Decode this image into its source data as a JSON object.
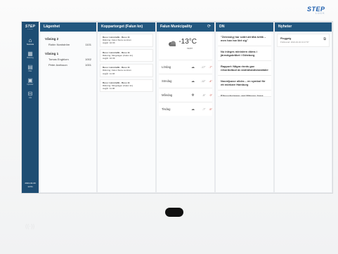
{
  "device": {
    "brand": "STEP",
    "brand_sub": "LOCK",
    "emboss": "((·))"
  },
  "sidebar": {
    "logo": "STEP",
    "logo_sub": "LOCK",
    "items": [
      {
        "label": "Startsida",
        "icon": "home-icon",
        "glyph": "⌂"
      },
      {
        "label": "Bokning",
        "icon": "calendar-icon",
        "glyph": "▦"
      },
      {
        "label": "Filer",
        "icon": "file-icon",
        "glyph": "▤"
      },
      {
        "label": "Nyheter",
        "icon": "newspaper-icon",
        "glyph": "▣"
      },
      {
        "label": "Lås",
        "icon": "lock-icon",
        "glyph": "⊟"
      }
    ],
    "date": "2024-02-09",
    "time": "14:51"
  },
  "lagenhet": {
    "title": "Lägenhet",
    "floors": [
      {
        "name": "Våning 2",
        "residents": [
          {
            "name": "Robin Nordström",
            "apt": "1101"
          }
        ]
      },
      {
        "name": "Våning 1",
        "residents": [
          {
            "name": "Tomas Engblom",
            "apt": "1002"
          },
          {
            "name": "Peter Axelsson",
            "apt": "1001"
          }
        ]
      }
    ]
  },
  "koppartorget": {
    "title": "Koppartorget (Falun kn)",
    "departures": [
      {
        "line": "Buss: Länstrafik - Buss 11",
        "dir": "Riktning: Falun Stora centrum",
        "arr": "Avgår: 10:33"
      },
      {
        "line": "Buss: Länstrafik - Buss 11",
        "dir": "Riktning: Slingvägen (Falun kn)",
        "arr": "Avgår: 10:36"
      },
      {
        "line": "Buss: Länstrafik - Buss 11",
        "dir": "Riktning: Falun Stora centrum",
        "arr": "Avgår: 11:03"
      },
      {
        "line": "Buss: Länstrafik - Buss 11",
        "dir": "Riktning: Slingvägen (Falun kn)",
        "arr": "Avgår: 11:06"
      }
    ]
  },
  "weather": {
    "title": "Falun Municipality",
    "now_temp": "-13°C",
    "now_cond": "mulet",
    "now_icon": "cloud-icon",
    "forecast": [
      {
        "day": "Lördag",
        "icon": "cloud-icon",
        "glyph": "☁",
        "lo": "-17°",
        "hi": "-7°"
      },
      {
        "day": "Söndag",
        "icon": "cloud-icon",
        "glyph": "☁",
        "lo": "-12°",
        "hi": "-4°"
      },
      {
        "day": "Måndag",
        "icon": "snow-icon",
        "glyph": "✻",
        "lo": "-5°",
        "hi": "0°"
      },
      {
        "day": "Tisdag",
        "icon": "cloud-icon",
        "glyph": "☁",
        "lo": "-7°",
        "hi": "-5°"
      }
    ]
  },
  "dn": {
    "title": "DN",
    "items": [
      "\"Zelenskyj har svårt att tåla kritik – men han har lärt sig\"",
      "Nu inleges ministern döms i järnvägsbråket i Göteborg",
      "Rapport: Några rinnts gav rekordutbud av andrahandsbostäder",
      "Noordjuuse olicks – en symbol för ett mörkare Hamburg",
      "Elbussbolagen vad Märnos linna"
    ]
  },
  "nyheter": {
    "title": "Nyheter",
    "items": [
      {
        "title": "Ploggnig",
        "date": "Publicerad: 2024-02-04 13:17:57"
      }
    ]
  }
}
